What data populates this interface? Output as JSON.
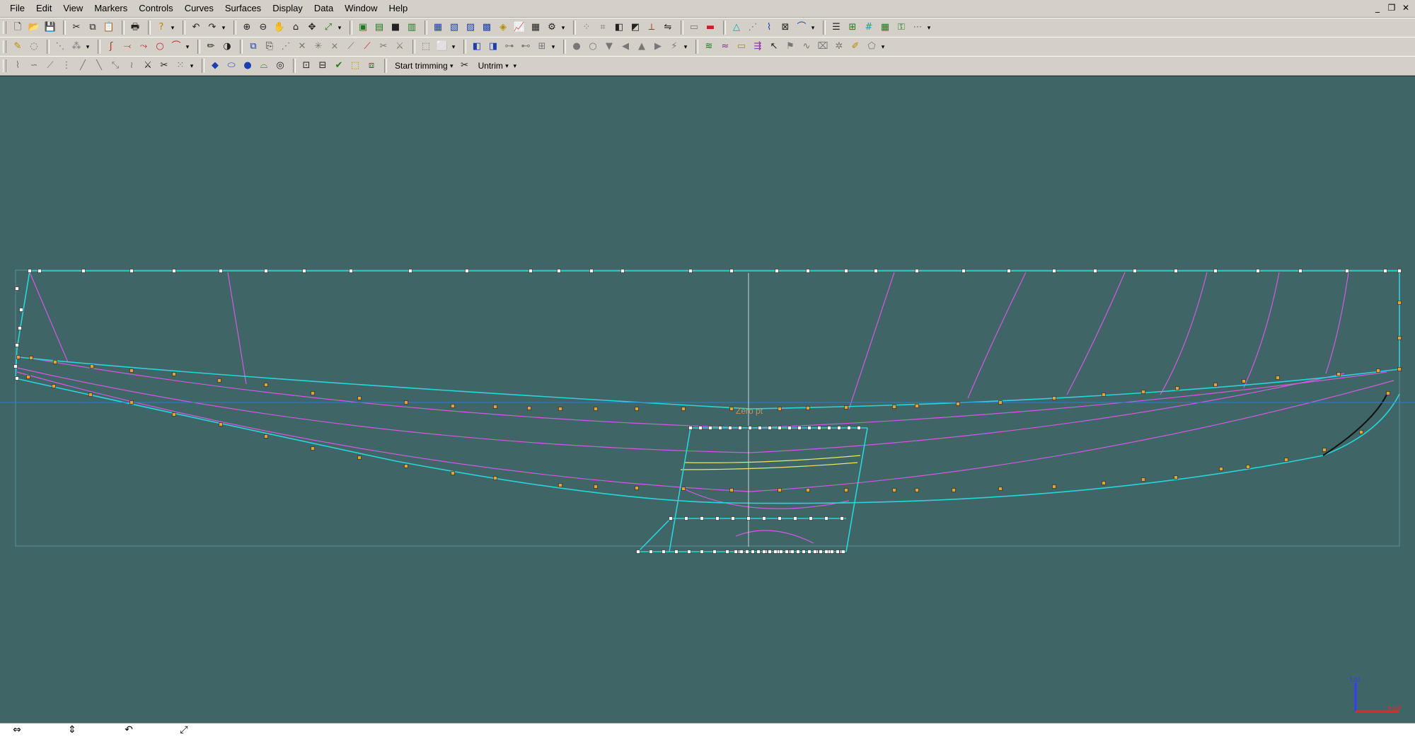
{
  "menu": [
    "File",
    "Edit",
    "View",
    "Markers",
    "Controls",
    "Curves",
    "Surfaces",
    "Display",
    "Data",
    "Window",
    "Help"
  ],
  "window_controls": {
    "minimize": "_",
    "restore": "❐",
    "close": "✕"
  },
  "toolbar3": {
    "start_trimming": "Start trimming",
    "untrim": "Untrim"
  },
  "viewport": {
    "zero_pt_label": "Zero pt",
    "axis_up": "Up",
    "axis_fwd": "Fwd",
    "colors": {
      "background": "#3f6566",
      "edge": "#27d6da",
      "contour": "#d05ce0",
      "highlight": "#e8e86a",
      "guide": "#c8d6d6",
      "waterline": "#2a7fd4",
      "control_point": "#e0a23a",
      "corner_point": "#ffffff",
      "axis_up": "#2f3fff",
      "axis_fwd": "#e02a2a"
    }
  },
  "statusbar": {
    "icons": [
      "pan-horizontal-icon",
      "pan-vertical-icon",
      "rotate-icon",
      "zoom-extents-icon"
    ]
  }
}
